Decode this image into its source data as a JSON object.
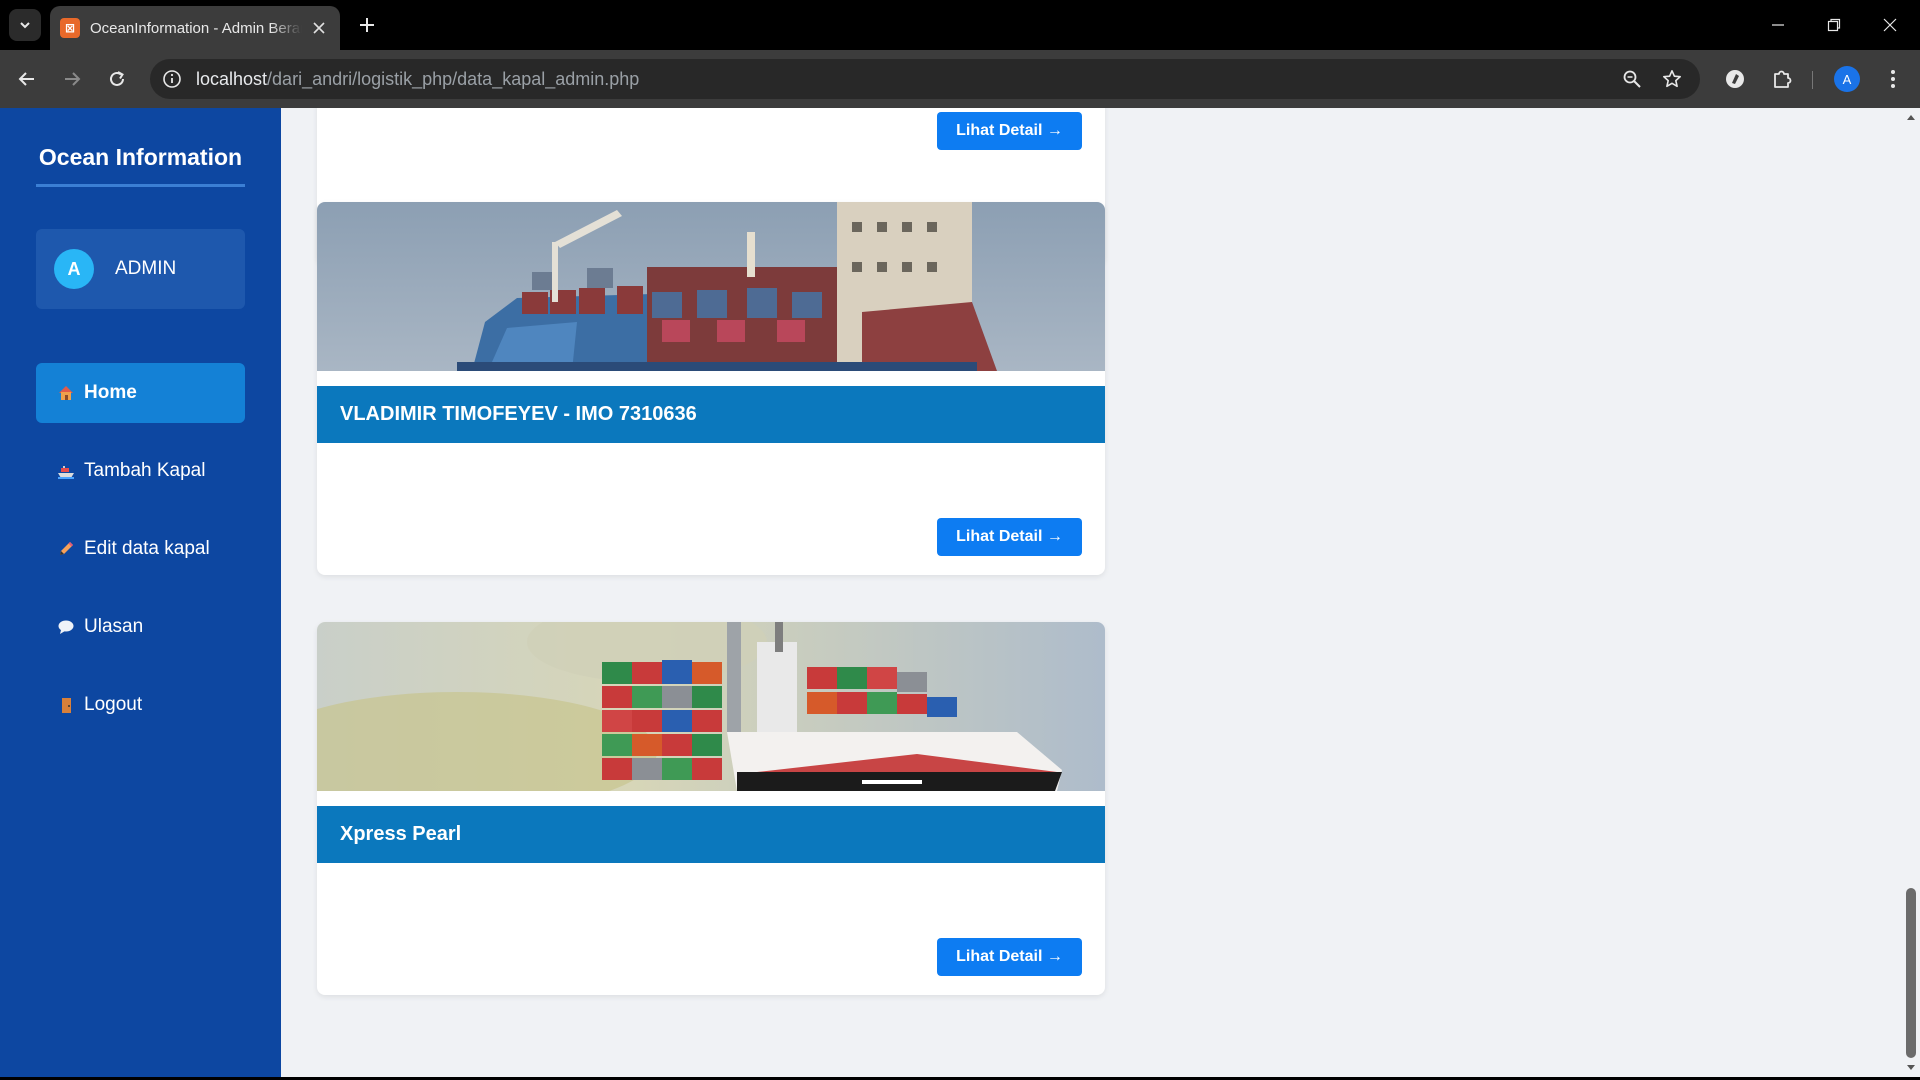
{
  "browser": {
    "tab": {
      "favicon": "xampp-icon",
      "title": "OceanInformation - Admin Beranda"
    },
    "url": {
      "host": "localhost",
      "path": "/dari_andri/logistik_php/data_kapal_admin.php"
    },
    "profile_initial": "A",
    "icons": [
      "tab-search-icon",
      "close-icon",
      "plus-icon",
      "back-arrow-icon",
      "forward-arrow-icon",
      "reload-icon",
      "site-info-icon",
      "zoom-icon",
      "star-icon",
      "extension-icon",
      "puzzle-icon",
      "kebab-menu-icon",
      "minimize-icon",
      "restore-icon",
      "window-close-icon"
    ]
  },
  "sidebar": {
    "brand": "Ocean Information",
    "user": {
      "initial": "A",
      "name": "ADMIN"
    },
    "menu": [
      {
        "icon": "house-icon",
        "label": "Home",
        "active": true
      },
      {
        "icon": "ship-icon",
        "label": "Tambah Kapal",
        "active": false
      },
      {
        "icon": "pencil-icon",
        "label": "Edit data kapal",
        "active": false
      },
      {
        "icon": "speech-bubble-icon",
        "label": "Ulasan",
        "active": false
      },
      {
        "icon": "door-icon",
        "label": "Logout",
        "active": false
      }
    ]
  },
  "cards": [
    {
      "title": "",
      "button": "Lihat Detail →"
    },
    {
      "title": "VLADIMIR TIMOFEYEV - IMO 7310636",
      "button": "Lihat Detail →"
    },
    {
      "title": "Xpress Pearl",
      "button": "Lihat Detail →"
    }
  ],
  "colors": {
    "sidebar": "#0d47a1",
    "menu_active": "#1481d6",
    "card_title": "#0b78bd",
    "button": "#0d7cf2",
    "page_bg": "#f0f2f5"
  }
}
